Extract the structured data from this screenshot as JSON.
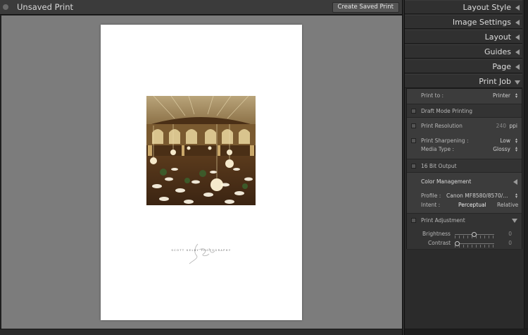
{
  "toolbar": {
    "title": "Unsaved Print",
    "create_saved_print_label": "Create Saved Print"
  },
  "print_page": {
    "signature_text": "SCOTT KELBY PHOTOGRAPHY"
  },
  "panel": {
    "sections": [
      {
        "label": "Layout Style",
        "state": "collapsed"
      },
      {
        "label": "Image Settings",
        "state": "collapsed"
      },
      {
        "label": "Layout",
        "state": "collapsed"
      },
      {
        "label": "Guides",
        "state": "collapsed"
      },
      {
        "label": "Page",
        "state": "collapsed"
      },
      {
        "label": "Print Job",
        "state": "expanded"
      }
    ],
    "print_job": {
      "print_to_label": "Print to :",
      "print_to_value": "Printer",
      "draft_mode_label": "Draft Mode Printing",
      "print_resolution_label": "Print Resolution",
      "print_resolution_value": "240",
      "print_resolution_unit": "ppi",
      "print_sharpening_label": "Print Sharpening :",
      "print_sharpening_value": "Low",
      "media_type_label": "Media Type :",
      "media_type_value": "Glossy",
      "bit_output_label": "16 Bit Output",
      "color_management": {
        "header": "Color Management",
        "profile_label": "Profile :",
        "profile_value": "Canon MF8580/8570/...",
        "intent_label": "Intent :",
        "intent_options": [
          "Perceptual",
          "Relative"
        ],
        "intent_selected": "Perceptual"
      },
      "print_adjustment": {
        "label": "Print Adjustment",
        "brightness_label": "Brightness",
        "brightness_value": "0",
        "contrast_label": "Contrast",
        "contrast_value": "0"
      }
    }
  },
  "colors": {
    "canvas_bg": "#7c7c7c",
    "panel_bg": "#2b2b2b",
    "panel_section_bg": "#3c3c3c",
    "paper": "#ffffff"
  }
}
